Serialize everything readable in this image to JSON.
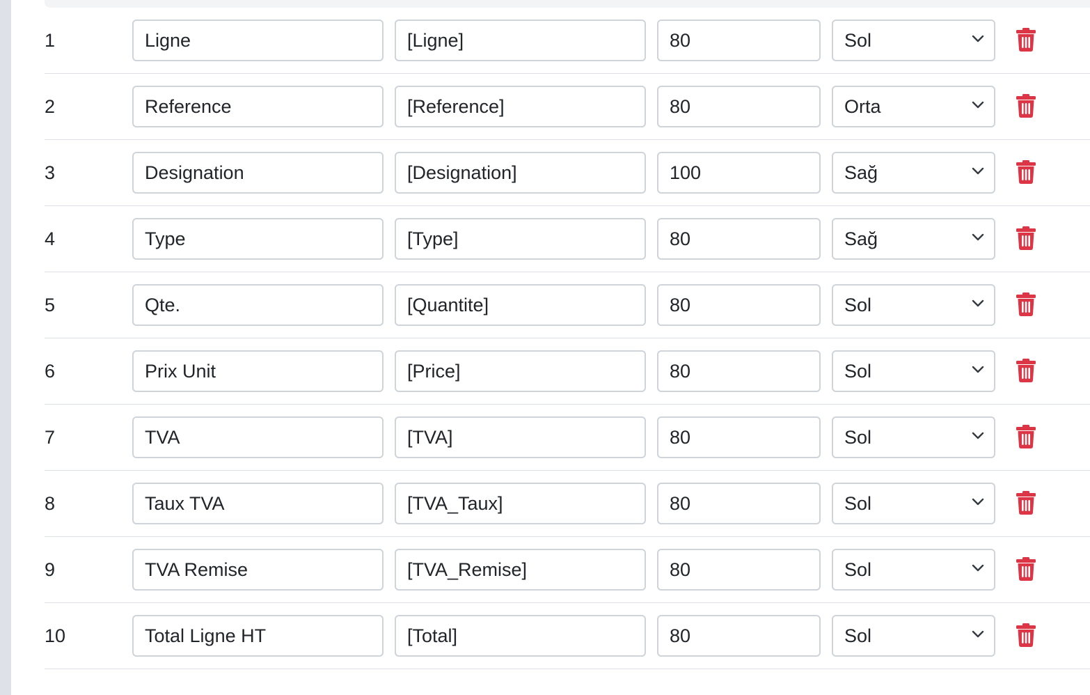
{
  "colors": {
    "delete": "#dc3545",
    "border": "#ced4da",
    "divider": "#dcdfe3"
  },
  "rows": [
    {
      "num": "1",
      "label": "Ligne",
      "variable": "[Ligne]",
      "width": "80",
      "align": "Sol"
    },
    {
      "num": "2",
      "label": "Reference",
      "variable": "[Reference]",
      "width": "80",
      "align": "Orta"
    },
    {
      "num": "3",
      "label": "Designation",
      "variable": "[Designation]",
      "width": "100",
      "align": "Sağ"
    },
    {
      "num": "4",
      "label": "Type",
      "variable": "[Type]",
      "width": "80",
      "align": "Sağ"
    },
    {
      "num": "5",
      "label": "Qte.",
      "variable": "[Quantite]",
      "width": "80",
      "align": "Sol"
    },
    {
      "num": "6",
      "label": "Prix Unit",
      "variable": "[Price]",
      "width": "80",
      "align": "Sol"
    },
    {
      "num": "7",
      "label": "TVA",
      "variable": "[TVA]",
      "width": "80",
      "align": "Sol"
    },
    {
      "num": "8",
      "label": "Taux TVA",
      "variable": "[TVA_Taux]",
      "width": "80",
      "align": "Sol"
    },
    {
      "num": "9",
      "label": "TVA Remise",
      "variable": "[TVA_Remise]",
      "width": "80",
      "align": "Sol"
    },
    {
      "num": "10",
      "label": "Total Ligne HT",
      "variable": "[Total]",
      "width": "80",
      "align": "Sol"
    }
  ],
  "icons": {
    "delete": "trash-icon",
    "select": "chevron-down-icon"
  }
}
